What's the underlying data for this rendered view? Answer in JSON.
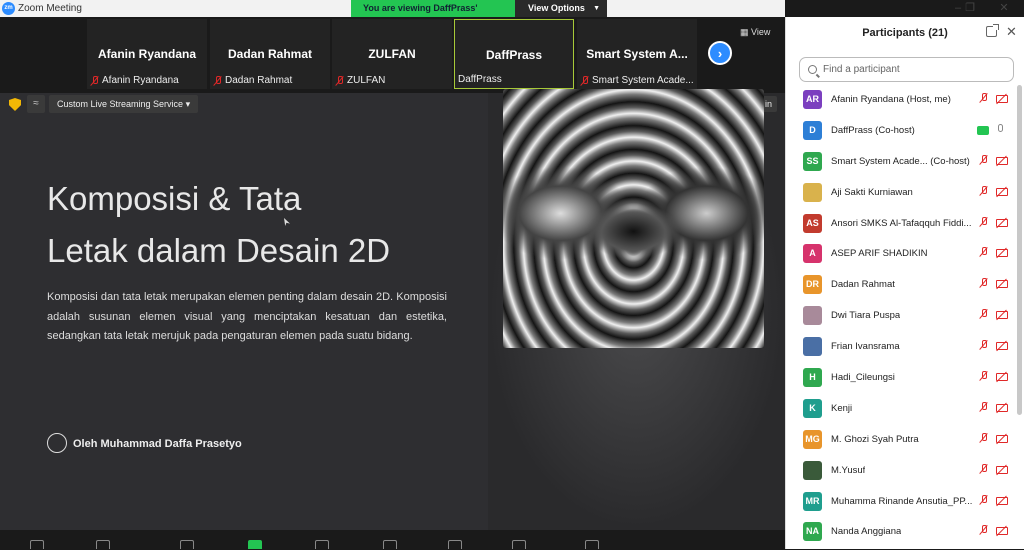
{
  "window": {
    "title": "Zoom Meeting",
    "banner_text": "You are viewing DaffPrass' screen",
    "view_options": "View Options",
    "view_label": "View"
  },
  "video_strip": [
    {
      "name": "Afanin Ryandana",
      "label": "Afanin Ryandana",
      "muted": true
    },
    {
      "name": "Dadan Rahmat",
      "label": "Dadan Rahmat",
      "muted": true
    },
    {
      "name": "ZULFAN",
      "label": "ZULFAN",
      "muted": true
    },
    {
      "name": "DaffPrass",
      "label": "DaffPrass",
      "muted": false
    },
    {
      "name": "Smart System A...",
      "label": "Smart System Acade...",
      "muted": true
    }
  ],
  "share": {
    "stream_label": "Custom Live Streaming Service",
    "sign_in": "Sign in",
    "slide_title_line1": "Komposisi & Tata",
    "slide_title_line2": "Letak dalam Desain 2D",
    "slide_body": "Komposisi dan tata letak merupakan elemen penting dalam desain 2D. Komposisi adalah susunan elemen visual yang menciptakan kesatuan dan estetika, sedangkan tata letak merujuk pada pengaturan elemen pada suatu bidang.",
    "author": "Oleh Muhammad Daffa Prasetyo"
  },
  "participants": {
    "title": "Participants (21)",
    "search_placeholder": "Find a participant",
    "items": [
      {
        "initials": "AR",
        "name": "Afanin Ryandana (Host, me)",
        "color": "#7b3fbf"
      },
      {
        "initials": "D",
        "name": "DaffPrass (Co-host)",
        "color": "#2d7fd6",
        "sharing": true
      },
      {
        "initials": "SS",
        "name": "Smart System Acade...  (Co-host)",
        "color": "#2fa84f"
      },
      {
        "initials": "",
        "name": "Aji Sakti Kurniawan",
        "color": "#d9b24c"
      },
      {
        "initials": "AS",
        "name": "Ansori SMKS Al-Tafaqquh Fiddi...",
        "color": "#c23b2e"
      },
      {
        "initials": "A",
        "name": "ASEP ARIF SHADIKIN",
        "color": "#d6336c"
      },
      {
        "initials": "DR",
        "name": "Dadan Rahmat",
        "color": "#e8952b"
      },
      {
        "initials": "",
        "name": "Dwi Tiara Puspa",
        "color": "#a88a9a"
      },
      {
        "initials": "",
        "name": "Frian Ivansrama",
        "color": "#4a6fa5"
      },
      {
        "initials": "H",
        "name": "Hadi_Cileungsi",
        "color": "#2fa84f"
      },
      {
        "initials": "K",
        "name": "Kenji",
        "color": "#1f9e8e"
      },
      {
        "initials": "MG",
        "name": "M. Ghozi Syah Putra",
        "color": "#e8952b"
      },
      {
        "initials": "",
        "name": "M.Yusuf",
        "color": "#3a5a3a"
      },
      {
        "initials": "MR",
        "name": "Muhamma Rinande Ansutia_PP...",
        "color": "#1f9e8e"
      },
      {
        "initials": "NA",
        "name": "Nanda  Anggiana",
        "color": "#2fa84f"
      }
    ]
  }
}
